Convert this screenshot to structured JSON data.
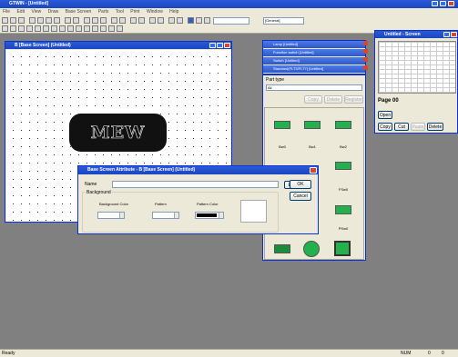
{
  "app": {
    "title": "GTWIN - [Untitled]"
  },
  "menu": [
    "File",
    "Edit",
    "View",
    "Draw",
    "Base Screen",
    "Parts",
    "Tool",
    "Print",
    "Window",
    "Help"
  ],
  "toolbar": {
    "combo_screen": "",
    "combo_layer": "[General]"
  },
  "screen_window": {
    "title": "B [Base Screen] (Untitled)"
  },
  "mew_object": {
    "text": "MEW"
  },
  "panels": [
    {
      "title": "Lamp  [Untitled]"
    },
    {
      "title": "Function switch  [Untitled]"
    },
    {
      "title": "Switch  [Untitled]"
    },
    {
      "title": "Standard(FLT3/FLT7)  [Untitled]"
    }
  ],
  "parts_panel": {
    "part_type_label": "Part type",
    "part_type_value": "All",
    "buttons": [
      "Copy",
      "Delete",
      "Register"
    ],
    "labels": [
      "Bw0",
      "Bw1",
      "Bw2",
      "FSw0",
      "PSw0"
    ]
  },
  "overview_window": {
    "title": "Untitled - Screen",
    "page_label": "Page 00",
    "buttons": [
      "Open",
      "Copy",
      "Cut",
      "Paste",
      "Delete"
    ]
  },
  "dialog": {
    "title": "Base Screen Attribute - B [Base Screen] (Untitled)",
    "name_label": "Name",
    "name_value": "",
    "eng_button": "Eng",
    "ok_button": "OK",
    "cancel_button": "Cancel",
    "background_group": "Background",
    "bg_color_label": "Background Color",
    "pattern_label": "Pattern",
    "pattern_color_label": "Pattern Color"
  },
  "status": {
    "left": "Ready",
    "right": [
      "NUM",
      "0",
      "0"
    ]
  }
}
